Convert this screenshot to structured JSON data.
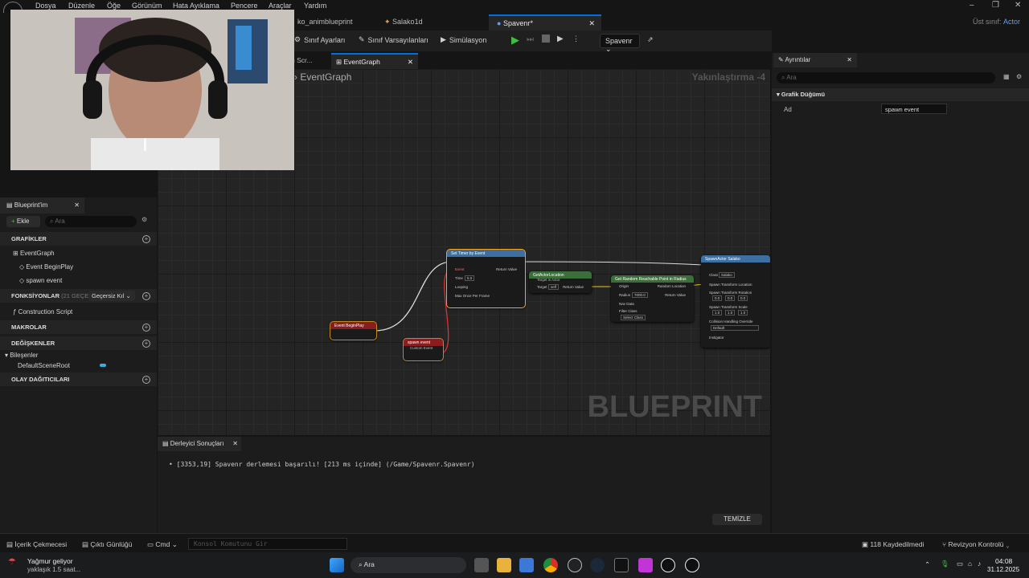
{
  "menu": [
    "Dosya",
    "Düzenle",
    "Öğe",
    "Görünüm",
    "Hata Ayıklama",
    "Pencere",
    "Araçlar",
    "Yardım"
  ],
  "parent_class": {
    "label": "Üst sınıf:",
    "value": "Actor"
  },
  "tabs": [
    {
      "label": "ko_animblueprint"
    },
    {
      "label": "Salako1d"
    },
    {
      "label": "Spavenr*"
    }
  ],
  "toolbar": {
    "class_settings": "Sınıf Ayarları",
    "class_defaults": "Sınıf Varsayılanları",
    "simulation": "Simülasyon",
    "debug_object": "Spavenr"
  },
  "graph_tabs": [
    "n Scr...",
    "EventGraph"
  ],
  "graph": {
    "breadcrumb": "EventGraph",
    "zoom": "Yakınlaştırma -4",
    "watermark": "BLUEPRINT",
    "nodes": {
      "set_timer": {
        "title": "Set Timer by Event",
        "pins": [
          "Event",
          "Time",
          "Looping",
          "Max Once Per Frame"
        ],
        "time_value": "5.0",
        "return": "Return Value"
      },
      "begin_play": {
        "title": "Event BeginPlay"
      },
      "spawn_event": {
        "title": "spawn event",
        "subtitle": "Custom Event"
      },
      "get_actor_location": {
        "title": "GetActorLocation",
        "subtitle": "Target is Actor",
        "target": "Target",
        "target_value": "self",
        "return": "Return Value"
      },
      "random_point": {
        "title": "Get Random Reachable Point in Radius",
        "origin": "Origin",
        "radius": "Radius",
        "radius_value": "7000.0",
        "nav_data": "Nav Data",
        "filter": "Filter Class",
        "filter_value": "Select Class",
        "random_location": "Random Location",
        "return": "Return Value"
      },
      "spawn_actor": {
        "title": "SpawnActor Salako",
        "class": "Class",
        "class_value": "Salako",
        "loc": "Spawn Transform Location",
        "rot": "Spawn Transform Rotation",
        "rot_values": [
          "0.0",
          "0.0",
          "0.0"
        ],
        "scale": "Spawn Transform Scale",
        "scale_values": [
          "1.0",
          "1.0",
          "1.0"
        ],
        "collision": "Collision Handling Override",
        "collision_value": "Default",
        "instigator": "Instigator"
      }
    }
  },
  "blueprint_panel": {
    "tab": "Blueprint'im",
    "add": "Ekle",
    "search_placeholder": "Ara",
    "graphs_header": "GRAFİKLER",
    "event_graph": "EventGraph",
    "event_beginplay": "Event BeginPlay",
    "spawn_event": "spawn event",
    "functions_header": "FONKSİYONLAR",
    "functions_count": "(21 GEÇERSİ",
    "override": "Geçersiz Kıl",
    "construction_script": "Construction Script",
    "macros_header": "MAKROLAR",
    "variables_header": "DEĞİŞKENLER",
    "components": "Bileşenler",
    "default_scene_root": "DefaultSceneRoot",
    "dispatchers_header": "OLAY DAĞITICILARI"
  },
  "details": {
    "tab": "Ayrıntılar",
    "search_placeholder": "Ara",
    "section": "Grafik Düğümü",
    "name_label": "Ad",
    "name_value": "spawn event"
  },
  "compiler": {
    "tab": "Derleyici Sonuçları",
    "message": "[3353,19] Spavenr derlemesi başarılı! [213 ms içinde] (/Game/Spavenr.Spavenr)",
    "clear": "TEMİZLE"
  },
  "statusbar": {
    "content_drawer": "İçerik Çekmecesi",
    "output_log": "Çıktı Günlüğü",
    "cmd": "Cmd",
    "console_placeholder": "Konsol Komutunu Gir",
    "unsaved": "118 Kaydedilmedi",
    "revision": "Revizyon Kontrolü"
  },
  "taskbar": {
    "weather_title": "Yağmur geliyor",
    "weather_sub": "yaklaşık 1.5 saat...",
    "search": "Ara",
    "time": "04:08",
    "date": "31.12.2025"
  }
}
